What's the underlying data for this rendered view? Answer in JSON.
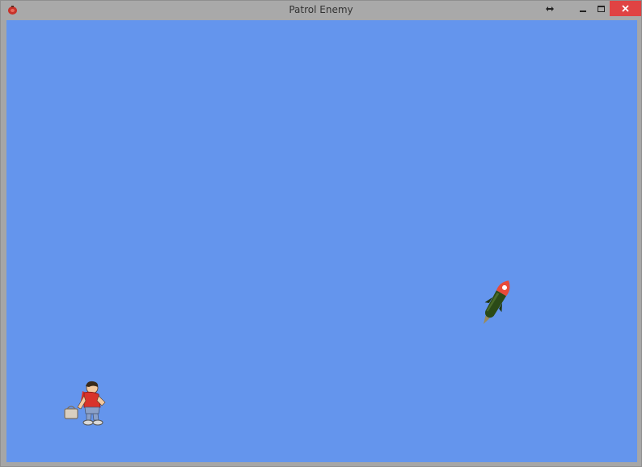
{
  "window": {
    "title": "Patrol Enemy",
    "icon": "app-icon",
    "controls": {
      "extra_icon": "resize-arrows-icon",
      "minimize_icon": "minimize-icon",
      "maximize_icon": "maximize-icon",
      "close_icon": "close-icon",
      "close_color": "#e04343"
    }
  },
  "game": {
    "background_color": "#6495ed",
    "sprites": {
      "player": "boy-player-sprite",
      "enemy": "rocket-enemy-sprite"
    }
  }
}
